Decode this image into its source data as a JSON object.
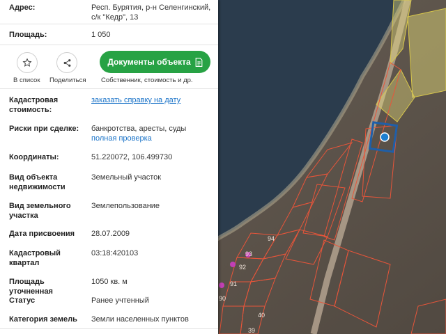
{
  "info": {
    "address_label": "Адрес:",
    "address_line1": "Респ. Бурятия, р-н Селенгинский,",
    "address_line2": "с/к \"Кедр\", 13",
    "area_label": "Площадь:",
    "area_value": "1 050"
  },
  "actions": {
    "favorite_label": "В список",
    "share_label": "Поделиться",
    "documents_button": "Документы объекта",
    "documents_caption": "Собственник, стоимость и др."
  },
  "details": [
    {
      "label_l1": "Кадастровая",
      "label_l2": "стоимость:",
      "value_l1": "заказать справку на дату",
      "value_l2": ""
    },
    {
      "label_l1": "Риски при сделке:",
      "label_l2": "",
      "value_l1": "банкротства, аресты, суды",
      "value_l2": "полная проверка"
    },
    {
      "label_l1": "Координаты:",
      "label_l2": "",
      "value_l1": "51.220072, 106.499730",
      "value_l2": ""
    },
    {
      "label_l1": "Вид объекта",
      "label_l2": "недвижимости",
      "value_l1": "Земельный участок",
      "value_l2": ""
    },
    {
      "label_l1": "Вид земельного",
      "label_l2": "участка",
      "value_l1": "Землепользование",
      "value_l2": ""
    },
    {
      "label_l1": "Дата присвоения",
      "label_l2": "",
      "value_l1": "28.07.2009",
      "value_l2": ""
    },
    {
      "label_l1": "Кадастровый",
      "label_l2": "квартал",
      "value_l1": "03:18:420103",
      "value_l2": ""
    },
    {
      "label_l1": "Площадь уточненная",
      "label_l2": "",
      "value_l1": "1050 кв. м",
      "value_l2": ""
    },
    {
      "label_l1": "Статус",
      "label_l2": "",
      "value_l1": "Ранее учтенный",
      "value_l2": ""
    },
    {
      "label_l1": "Категория земель",
      "label_l2": "",
      "value_l1": "Земли населенных пунктов",
      "value_l2": ""
    }
  ],
  "map": {
    "parcel_numbers": [
      "94",
      "92",
      "91",
      "90",
      "40",
      "39",
      "93"
    ],
    "colors": {
      "water": "#2b3c4d",
      "land": "#5a5048",
      "parcel_border": "#e8553a",
      "selected_border": "#1f5fa8",
      "marker": "#1d7fd1",
      "yellow_zone": "#e8df7a"
    }
  }
}
